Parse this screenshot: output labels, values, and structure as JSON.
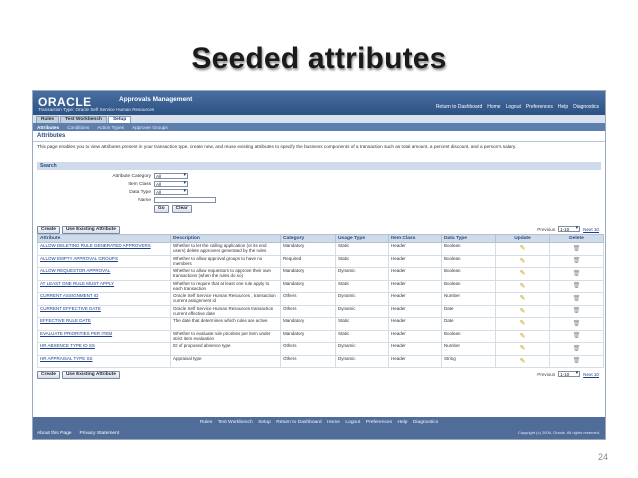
{
  "slide": {
    "title": "Seeded attributes",
    "page_number": "24"
  },
  "header": {
    "logo": "ORACLE",
    "app_name": "Approvals Management",
    "transaction_type": "Transaction Type: Oracle Self Service Human Resources",
    "global_links": [
      "Return to Dashboard",
      "Home",
      "Logout",
      "Preferences",
      "Help",
      "Diagnostics"
    ]
  },
  "tabs": [
    {
      "label": "Rules",
      "active": false
    },
    {
      "label": "Test Workbench",
      "active": false
    },
    {
      "label": "Setup",
      "active": true
    }
  ],
  "subtabs": [
    {
      "label": "Attributes",
      "active": true
    },
    {
      "label": "Conditions",
      "active": false
    },
    {
      "label": "Action Types",
      "active": false
    },
    {
      "label": "Approver Groups",
      "active": false
    }
  ],
  "page": {
    "title": "Attributes",
    "intro": "This page enables you to view attributes present in your transaction type, create new, and reuse existing attributes to specify the business components of a transaction such as total amount, a percent discount, and a person's salary."
  },
  "search": {
    "header": "Search",
    "fields": {
      "category_label": "Attribute Category",
      "category_value": "All",
      "item_class_label": "Item Class",
      "item_class_value": "All",
      "data_type_label": "Data Type",
      "data_type_value": "All",
      "name_label": "Name",
      "name_value": ""
    },
    "go_label": "Go",
    "clear_label": "Clear"
  },
  "table_toolbar": {
    "create_label": "Create",
    "use_existing_label": "Use Existing Attribute",
    "previous_label": "Previous",
    "range_value": "1-10",
    "next_label": "Next 10"
  },
  "table": {
    "columns": [
      "Attribute",
      "Description",
      "Category",
      "Usage Type",
      "Item Class",
      "Data Type",
      "Update",
      "Delete"
    ],
    "rows": [
      {
        "attribute": "ALLOW DELETING RULE GENERATED APPROVERS",
        "description": "Whether to let the calling application (or its end users) delete approvers generated by the rules",
        "category": "Mandatory",
        "usage": "Static",
        "item_class": "Header",
        "data_type": "Boolean"
      },
      {
        "attribute": "ALLOW EMPTY APPROVAL GROUPS",
        "description": "Whether to allow approval groups to have no members",
        "category": "Required",
        "usage": "Static",
        "item_class": "Header",
        "data_type": "Boolean"
      },
      {
        "attribute": "ALLOW REQUESTOR APPROVAL",
        "description": "Whether to allow requestors to approve their own transactions (when the rules do so)",
        "category": "Mandatory",
        "usage": "Dynamic",
        "item_class": "Header",
        "data_type": "Boolean"
      },
      {
        "attribute": "AT LEAST ONE RULE MUST APPLY",
        "description": "Whether to require that at least one rule apply to each transaction",
        "category": "Mandatory",
        "usage": "Static",
        "item_class": "Header",
        "data_type": "Boolean"
      },
      {
        "attribute": "CURRENT ASSIGNMENT ID",
        "description": "Oracle Self Service Human Resources , transaction current assignment id",
        "category": "Others",
        "usage": "Dynamic",
        "item_class": "Header",
        "data_type": "Number"
      },
      {
        "attribute": "CURRENT EFFECTIVE DATE",
        "description": "Oracle Self Service Human Resources transaction current effective date",
        "category": "Others",
        "usage": "Dynamic",
        "item_class": "Header",
        "data_type": "Date"
      },
      {
        "attribute": "EFFECTIVE RULE DATE",
        "description": "The date that determines which rules are active",
        "category": "Mandatory",
        "usage": "Static",
        "item_class": "Header",
        "data_type": "Date"
      },
      {
        "attribute": "EVALUATE PRIORITIES PER ITEM",
        "description": "Whether to evaluate rule priorities per item under strict item evaluation",
        "category": "Mandatory",
        "usage": "Static",
        "item_class": "Header",
        "data_type": "Boolean"
      },
      {
        "attribute": "HR ABSENCE TYPE ID SS",
        "description": "ID of proposed absence type",
        "category": "Others",
        "usage": "Dynamic",
        "item_class": "Header",
        "data_type": "Number"
      },
      {
        "attribute": "HR APPRAISAL TYPE SS",
        "description": "Appraisal type",
        "category": "Others",
        "usage": "Dynamic",
        "item_class": "Header",
        "data_type": "String"
      }
    ]
  },
  "footer": {
    "links": [
      "Rules",
      "Test Workbench",
      "Setup",
      "Return to Dashboard",
      "Home",
      "Logout",
      "Preferences",
      "Help",
      "Diagnostics"
    ],
    "about": "About this Page",
    "privacy": "Privacy Statement",
    "copyright": "Copyright (c) 2006, Oracle. All rights reserved."
  },
  "icons": {
    "update": "pencil-icon",
    "delete": "trash-icon"
  },
  "colors": {
    "header_blue": "#2c5183",
    "link_blue": "#1c3f8a",
    "table_header_bg": "#cfdaea"
  }
}
